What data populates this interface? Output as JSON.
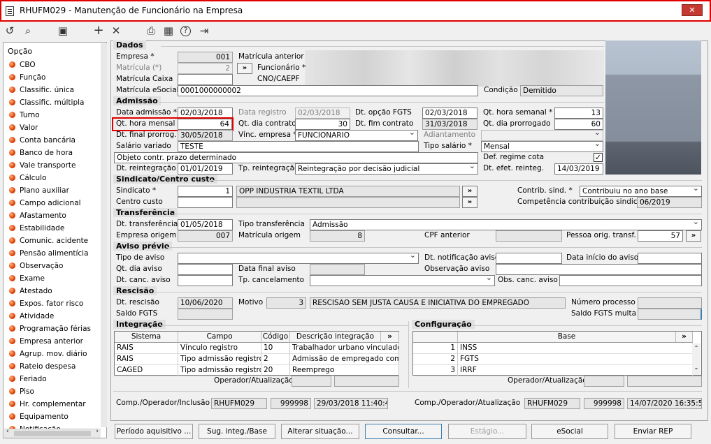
{
  "window": {
    "title": "RHUFM029 - Manutenção de Funcionário na Empresa",
    "close": "✕"
  },
  "toolbar": {
    "refresh": "↺",
    "search": "⌕",
    "save": "▣",
    "add": "+",
    "cancel": "✕",
    "print": "⎙",
    "calendar": "▦",
    "help": "?",
    "exit": "⇥"
  },
  "sidebar": {
    "title": "Opção",
    "items": [
      "CBO",
      "Função",
      "Classific. única",
      "Classific. múltipla",
      "Turno",
      "Valor",
      "Conta bancária",
      "Banco de hora",
      "Vale transporte",
      "Cálculo",
      "Plano auxiliar",
      "Campo adicional",
      "Afastamento",
      "Estabilidade",
      "Comunic. acidente",
      "Pensão alimentícia",
      "Observação",
      "Exame",
      "Atestado",
      "Expos. fator risco",
      "Atividade",
      "Programação férias",
      "Empresa anterior",
      "Agrup. mov. diário",
      "Rateio despesa",
      "Feriado",
      "Piso",
      "Hr. complementar",
      "Equipamento",
      "Notificação"
    ]
  },
  "dados": {
    "section": "Dados",
    "empresa_label": "Empresa *",
    "empresa": "001",
    "matricula_label": "Matrícula (*)",
    "matricula": "2",
    "mat_caixa_label": "Matrícula Caixa",
    "mat_esocial_label": "Matrícula eSocial",
    "mat_esocial": "0001000000002",
    "mat_anterior_label": "Matrícula anterior",
    "funcionario_label": "Funcionário *",
    "cno_label": "CNO/CAEPF",
    "condicao_label": "Condição",
    "condicao": "Demitido",
    "go": "»"
  },
  "admissao": {
    "section": "Admissão",
    "data_adm_label": "Data admissão *",
    "data_adm": "02/03/2018",
    "data_reg_label": "Data registro",
    "data_reg": "02/03/2018",
    "dt_fgts_label": "Dt. opção FGTS",
    "dt_fgts": "02/03/2018",
    "qt_sem_label": "Qt. hora semanal *",
    "qt_sem": "13",
    "qt_mensal_label": "Qt. hora mensal *",
    "qt_mensal": "64",
    "qt_dia_contrato_label": "Qt. dia contrato",
    "qt_dia_contrato": "30",
    "dt_fim_label": "Dt. fim contrato",
    "dt_fim": "31/03/2018",
    "qt_dia_prorr_label": "Qt. dia prorrogado",
    "qt_dia_prorr": "60",
    "dt_final_prorrog_label": "Dt. final prorrog.",
    "dt_final_prorrog": "30/05/2018",
    "vinc_label": "Vínc. empresa *",
    "vinc": "FUNCIONARIO",
    "adiantamento_label": "Adiantamento",
    "salario_var_label": "Salário variado",
    "salario_var": "TESTE",
    "tipo_sal_label": "Tipo salário *",
    "tipo_sal": "Mensal",
    "objeto_label": "Objeto contr. prazo determinado",
    "def_cota_label": "Def. regime cota",
    "def_cota_check": "✓",
    "dt_reint_label": "Dt. reintegração",
    "dt_reint": "01/01/2019",
    "tp_reint_label": "Tp. reintegração",
    "tp_reint": "Reintegração por decisão judicial",
    "dt_efet_label": "Dt. efet. reinteg.",
    "dt_efet": "14/03/2019"
  },
  "sindicato": {
    "section": "Sindicato/Centro custo",
    "sind_label": "Sindicato *",
    "sind_code": "1",
    "sind_name": "OPP INDUSTRIA TEXTIL LTDA",
    "centro_label": "Centro custo",
    "contrib_label": "Contrib. sind. *",
    "contrib": "Contribuiu no ano base",
    "comp_label": "Competência contribuição sindical",
    "comp": "06/2019"
  },
  "transferencia": {
    "section": "Transferência",
    "dt_label": "Dt. transferência",
    "dt": "01/05/2018",
    "tipo_label": "Tipo transferência",
    "tipo": "Admissão",
    "emp_orig_label": "Empresa origem",
    "emp_orig": "007",
    "mat_orig_label": "Matrícula origem",
    "mat_orig": "8",
    "cpf_label": "CPF anterior",
    "pessoa_label": "Pessoa orig. transf.",
    "pessoa": "57"
  },
  "aviso": {
    "section": "Aviso prévio",
    "tipo_label": "Tipo de aviso",
    "dt_notif_label": "Dt. notificação aviso",
    "dt_inicio_label": "Data início do aviso",
    "qt_dia_label": "Qt. dia aviso",
    "dt_final_label": "Data final aviso",
    "obs_label": "Observação aviso",
    "dt_canc_label": "Dt. canc. aviso",
    "tp_canc_label": "Tp. cancelamento",
    "obs_canc_label": "Obs. canc. aviso"
  },
  "rescisao": {
    "section": "Rescisão",
    "dt_label": "Dt. rescisão",
    "dt": "10/06/2020",
    "motivo_label": "Motivo",
    "motivo_code": "3",
    "motivo": "RESCISAO SEM JUSTA CAUSA E INICIATIVA DO EMPREGADO",
    "num_proc_label": "Número processo",
    "saldo_label": "Saldo FGTS",
    "saldo_multa_label": "Saldo FGTS multa"
  },
  "integracao": {
    "section": "Integração",
    "cols": [
      "Sistema",
      "Campo",
      "Código",
      "Descrição integração"
    ],
    "rows": [
      [
        "RAIS",
        "Vínculo registro",
        "10",
        "Trabalhador urbano vinculado a"
      ],
      [
        "RAIS",
        "Tipo admissão registro",
        "2",
        "Admissão de empregado com e"
      ],
      [
        "CAGED",
        "Tipo admissão registro",
        "20",
        "Reemprego"
      ]
    ],
    "operador_label": "Operador/Atualização"
  },
  "configuracao": {
    "section": "Configuração",
    "col": "Base",
    "rows": [
      [
        "1",
        "INSS"
      ],
      [
        "2",
        "FGTS"
      ],
      [
        "3",
        "IRRF"
      ]
    ],
    "operador_label": "Operador/Atualização"
  },
  "footer": {
    "comp_inc_label": "Comp./Operador/Inclusão",
    "comp_inc": "RHUFM029",
    "op_inc": "999998",
    "dt_inc": "29/03/2018 11:40:47",
    "comp_at_label": "Comp./Operador/Atualização",
    "comp_at": "RHUFM029",
    "op_at": "999998",
    "dt_at": "14/07/2020 16:35:52"
  },
  "buttons": [
    "Período aquisitivo ...",
    "Sug. integ./Base",
    "Alterar situação...",
    "Consultar...",
    "Estágio...",
    "eSocial",
    "Enviar REP"
  ]
}
